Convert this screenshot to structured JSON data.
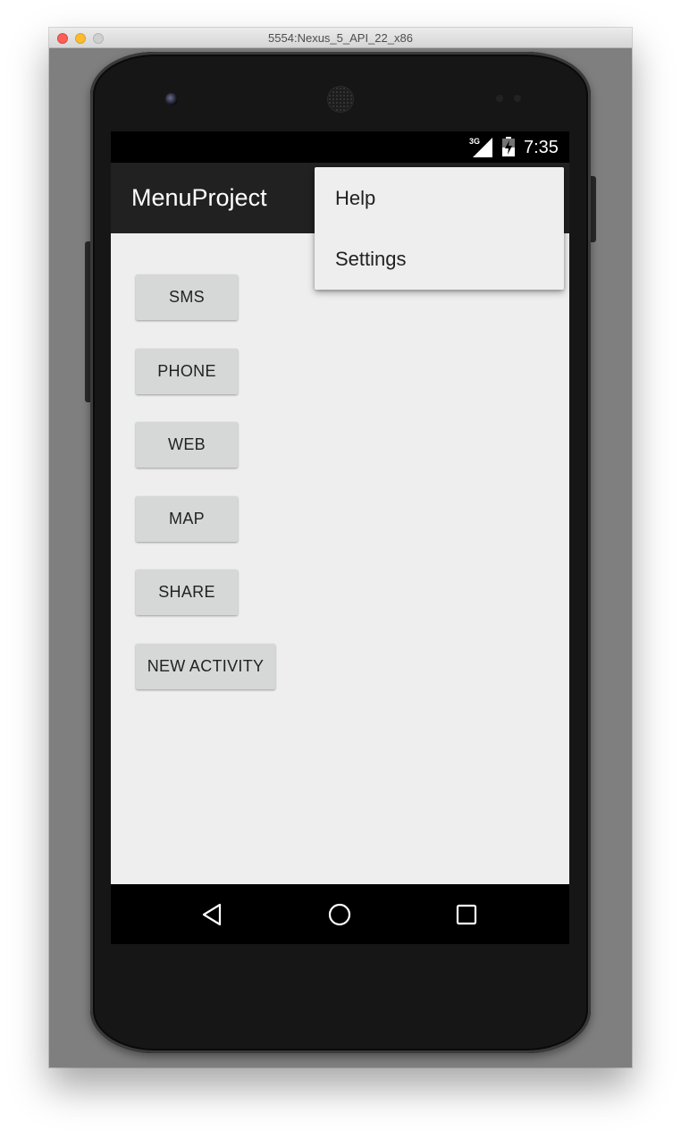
{
  "window": {
    "title": "5554:Nexus_5_API_22_x86"
  },
  "status_bar": {
    "network": "3G",
    "time": "7:35",
    "icons": [
      "signal-icon",
      "battery-icon"
    ]
  },
  "app_bar": {
    "title": "MenuProject"
  },
  "overflow_menu": {
    "items": [
      {
        "label": "Help"
      },
      {
        "label": "Settings"
      }
    ]
  },
  "buttons": [
    {
      "label": "SMS"
    },
    {
      "label": "PHONE"
    },
    {
      "label": "WEB"
    },
    {
      "label": "MAP"
    },
    {
      "label": "SHARE"
    },
    {
      "label": "NEW ACTIVITY"
    }
  ],
  "nav_bar": {
    "icons": [
      "back-icon",
      "home-icon",
      "recents-icon"
    ]
  },
  "colors": {
    "app_bar": "#212121",
    "status_bar": "#000000",
    "background": "#eeeeee",
    "button": "#d6d7d7",
    "menu": "#eeeeee"
  }
}
